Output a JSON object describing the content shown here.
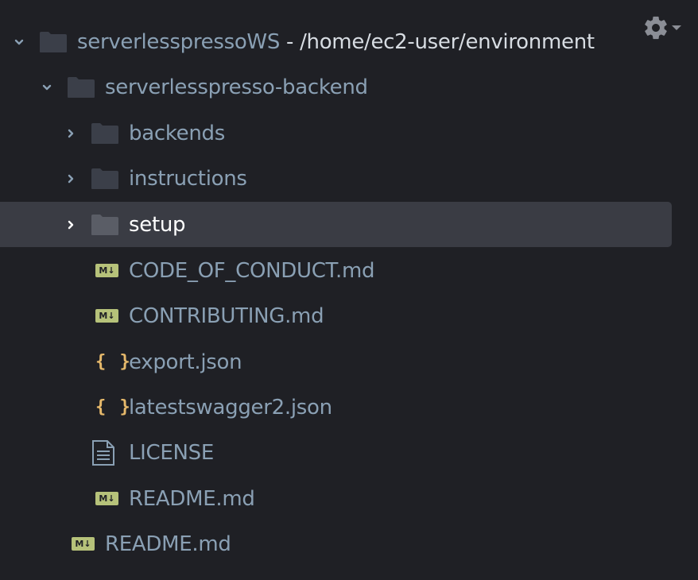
{
  "tree": {
    "root": {
      "name": "serverlesspressoWS",
      "separator": " - ",
      "path": "/home/ec2-user/environment"
    },
    "items": [
      {
        "label": "serverlesspresso-backend"
      },
      {
        "label": "backends"
      },
      {
        "label": "instructions"
      },
      {
        "label": "setup"
      },
      {
        "label": "CODE_OF_CONDUCT.md"
      },
      {
        "label": "CONTRIBUTING.md"
      },
      {
        "label": "export.json"
      },
      {
        "label": "latestswagger2.json"
      },
      {
        "label": "LICENSE"
      },
      {
        "label": "README.md"
      },
      {
        "label": "README.md"
      }
    ]
  },
  "icons": {
    "md_badge": "M↓",
    "json_glyph": "{ }"
  },
  "colors": {
    "background": "#1f2025",
    "text": "#8aa0b4",
    "selected_bg": "#3a3c44",
    "md_badge": "#b6c27a",
    "json_icon": "#e6b96b",
    "folder": "#3b3f49"
  }
}
